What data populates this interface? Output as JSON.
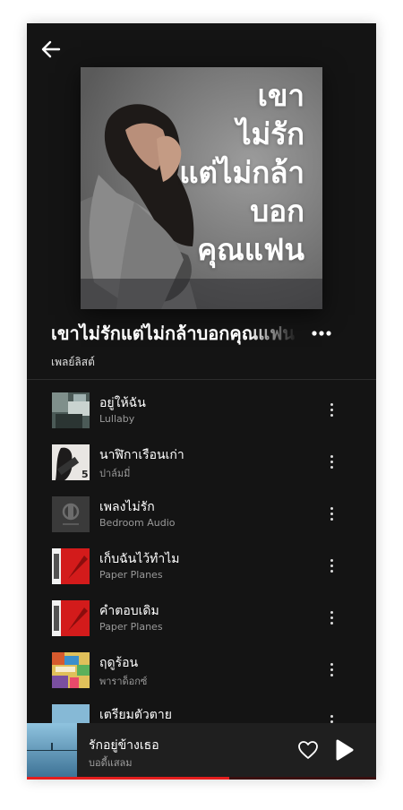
{
  "header": {
    "back_icon": "arrow-left-icon"
  },
  "cover": {
    "lines": [
      "เขา",
      "ไม่รัก",
      "แต่ไม่กล้า",
      "บอก",
      "คุณแฟน"
    ]
  },
  "playlist": {
    "title": "เขาไม่รักแต่ไม่กล้าบอกคุณแฟน",
    "type": "เพลย์ลิสต์",
    "more_icon": "more-horizontal-icon"
  },
  "tracks": [
    {
      "title": "อยู่ให้ฉัน",
      "artist": "Lullaby"
    },
    {
      "title": "นาฬิกาเรือนเก่า",
      "artist": "ปาล์มมี่"
    },
    {
      "title": "เพลงไม่รัก",
      "artist": "Bedroom Audio"
    },
    {
      "title": "เก็บฉันไว้ทำไม",
      "artist": "Paper Planes"
    },
    {
      "title": "คำตอบเดิม",
      "artist": "Paper Planes"
    },
    {
      "title": "ฤดูร้อน",
      "artist": "พาราด็อกซ์"
    },
    {
      "title": "เตรียมตัวตาย",
      "artist": ""
    }
  ],
  "player": {
    "title": "รักอยู่ข้างเธอ",
    "artist": "บอดี้แสลม",
    "heart_icon": "heart-outline-icon",
    "play_icon": "play-icon",
    "progress": 0.58
  },
  "colors": {
    "background": "#141414",
    "accent": "#e41e1e",
    "player_bg": "#1f1f1f"
  }
}
